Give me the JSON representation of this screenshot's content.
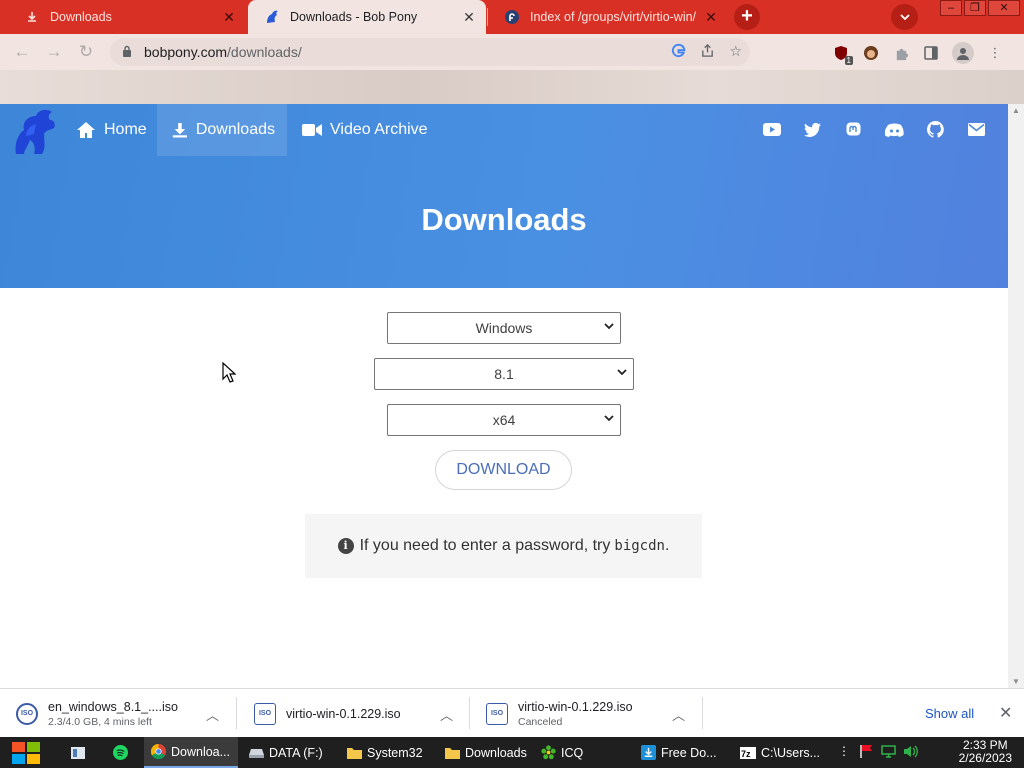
{
  "tabs": [
    {
      "title": "Downloads",
      "favicon": "download-favicon-icon"
    },
    {
      "title": "Downloads - Bob Pony",
      "favicon": "bobpony-favicon-icon"
    },
    {
      "title": "Index of /groups/virt/virtio-win/",
      "favicon": "fedora-favicon-icon"
    }
  ],
  "toolbar": {
    "url_host": "bobpony.com",
    "url_path": "/downloads/",
    "extension_badge": "1"
  },
  "site": {
    "nav": [
      {
        "label": "Home",
        "icon": "home-icon"
      },
      {
        "label": "Downloads",
        "icon": "download-icon"
      },
      {
        "label": "Video Archive",
        "icon": "video-camera-icon"
      }
    ],
    "social_icons": [
      "youtube-icon",
      "twitter-icon",
      "mastodon-icon",
      "discord-icon",
      "github-icon",
      "email-icon"
    ],
    "page_title": "Downloads",
    "os_select": "Windows",
    "version_select": "8.1",
    "arch_select": "x64",
    "download_button": "DOWNLOAD",
    "note_text": "If you need to enter a password, try",
    "note_code": "bigcdn",
    "note_end": ".",
    "hero_color": "#4a90e2"
  },
  "shelf": {
    "items": [
      {
        "name": "en_windows_8.1_....iso",
        "sub": "2.3/4.0 GB, 4 mins left"
      },
      {
        "name": "virtio-win-0.1.229.iso",
        "sub": ""
      },
      {
        "name": "virtio-win-0.1.229.iso",
        "sub": "Canceled"
      }
    ],
    "show_all": "Show all"
  },
  "taskbar": {
    "tasks": [
      {
        "label": "Downloa..."
      },
      {
        "label": "DATA (F:)"
      },
      {
        "label": "System32"
      },
      {
        "label": "Downloads"
      },
      {
        "label": "ICQ"
      },
      {
        "label": "Free Do..."
      },
      {
        "label": "C:\\Users..."
      }
    ],
    "time": "2:33 PM",
    "date": "2/26/2023"
  }
}
